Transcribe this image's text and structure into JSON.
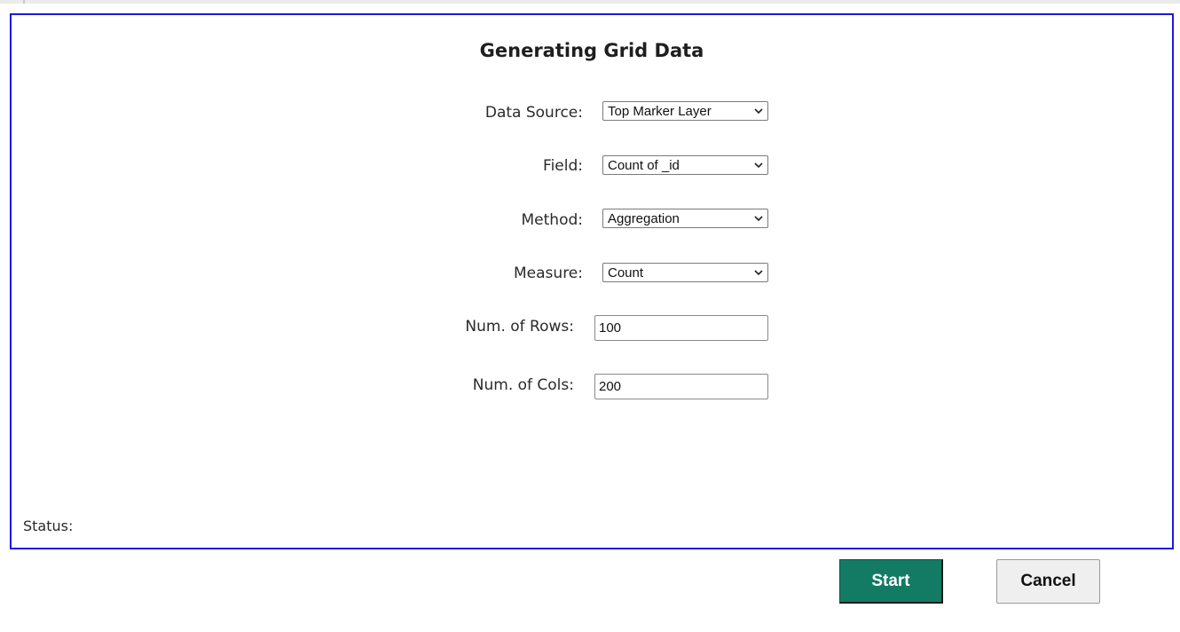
{
  "dialog": {
    "title": "Generating Grid Data",
    "status_label": "Status:",
    "status_value": ""
  },
  "form": {
    "data_source": {
      "label": "Data Source:",
      "value": "Top Marker Layer"
    },
    "field": {
      "label": "Field:",
      "value": "Count of _id"
    },
    "method": {
      "label": "Method:",
      "value": "Aggregation"
    },
    "measure": {
      "label": "Measure:",
      "value": "Count"
    },
    "num_rows": {
      "label": "Num. of Rows:",
      "value": "100"
    },
    "num_cols": {
      "label": "Num. of Cols:",
      "value": "200"
    }
  },
  "buttons": {
    "start_label": "Start",
    "cancel_label": "Cancel"
  },
  "colors": {
    "panel_border": "#1a1adb",
    "start_button": "#137a64",
    "cancel_button": "#efefef"
  },
  "icons": {
    "dropdown": "chevron-down-icon"
  }
}
